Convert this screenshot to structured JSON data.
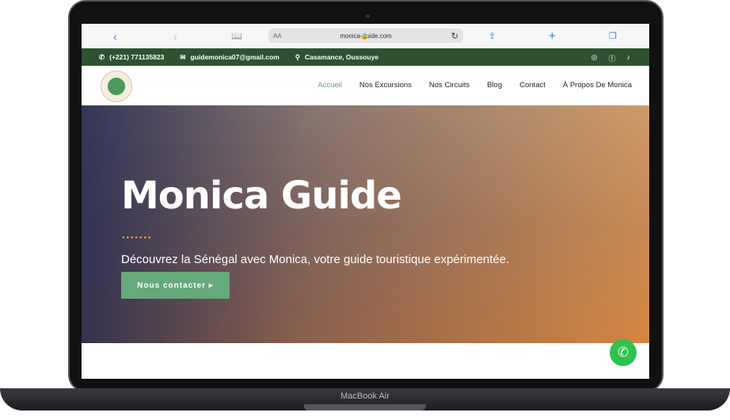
{
  "browser": {
    "url": "monica-guide.com",
    "aa": "AA"
  },
  "topbar": {
    "phone": "(+221) 771135823",
    "email": "guidemonica07@gmail.com",
    "location": "Casamance, Oussouye"
  },
  "nav": {
    "items": [
      "Accueil",
      "Nos Excursions",
      "Nos Circuits",
      "Blog",
      "Contact",
      "À Propos De Monica"
    ]
  },
  "hero": {
    "title": "Monica Guide",
    "dots": "•••••••",
    "subtitle": "Découvrez la Sénégal avec Monica, votre guide touristique expérimentée.",
    "button": "Nous contacter ▸"
  },
  "device": {
    "label": "MacBook Air"
  }
}
